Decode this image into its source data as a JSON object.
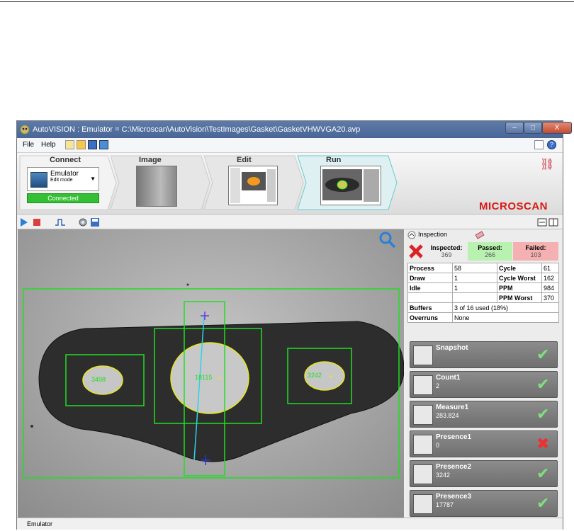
{
  "window": {
    "title": "AutoVISION : Emulator  =  C:\\Microscan\\AutoVision\\TestImages\\Gasket\\GasketVHWVGA20.avp",
    "min_label": "–",
    "max_label": "□",
    "close_label": "X"
  },
  "menu": {
    "file": "File",
    "help": "Help"
  },
  "wizard": {
    "steps": [
      "Connect",
      "Image",
      "Edit",
      "Run"
    ],
    "device_name": "Emulator",
    "device_mode": "Edit mode",
    "status": "Connected",
    "brand": "MICROSCAN"
  },
  "inspection": {
    "label": "Inspection",
    "inspected_label": "Inspected:",
    "inspected_value": "369",
    "passed_label": "Passed:",
    "passed_value": "266",
    "failed_label": "Failed:",
    "failed_value": "103"
  },
  "stats": {
    "process_label": "Process",
    "process": "58",
    "cycle_label": "Cycle",
    "cycle": "61",
    "draw_label": "Draw",
    "draw": "1",
    "cycle_worst_label": "Cycle Worst",
    "cycle_worst": "162",
    "idle_label": "Idle",
    "idle": "1",
    "ppm_label": "PPM",
    "ppm": "984",
    "ppm_worst_label": "PPM Worst",
    "ppm_worst": "370",
    "buffers_label": "Buffers",
    "buffers": "3 of 16 used (18%)",
    "overruns_label": "Overruns",
    "overruns": "None"
  },
  "tools": [
    {
      "name": "Snapshot",
      "value": "",
      "status": "pass"
    },
    {
      "name": "Count1",
      "value": "2",
      "status": "pass"
    },
    {
      "name": "Measure1",
      "value": "283.824",
      "status": "pass"
    },
    {
      "name": "Presence1",
      "value": "0",
      "status": "fail"
    },
    {
      "name": "Presence2",
      "value": "3242",
      "status": "pass"
    },
    {
      "name": "Presence3",
      "value": "17787",
      "status": "pass"
    }
  ],
  "overlay": {
    "left_label": "3498",
    "center_label": "18115",
    "right_label": "3242"
  },
  "statusbar": {
    "text": "Emulator"
  },
  "colors": {
    "pass": "#7ee07e",
    "fail": "#ee3030",
    "overlay_green": "#22dd22",
    "brand_red": "#d91a12"
  }
}
